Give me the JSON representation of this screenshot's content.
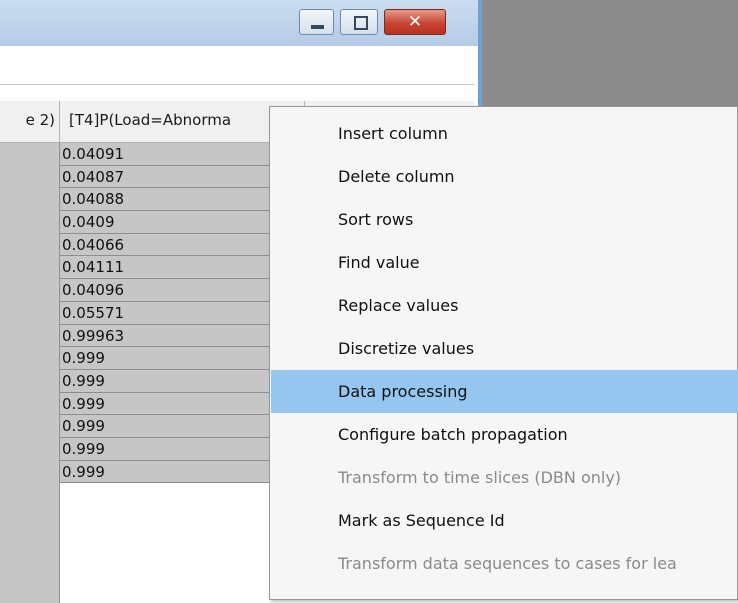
{
  "window": {
    "close_label": "✕"
  },
  "grid": {
    "headers": [
      "e 2)",
      "[T4]P(Load=Abnorma",
      ""
    ],
    "values": [
      "0.04091",
      "0.04087",
      "0.04088",
      "0.0409",
      "0.04066",
      "0.04111",
      "0.04096",
      "0.05571",
      "0.99963",
      "0.999",
      "0.999",
      "0.999",
      "0.999",
      "0.999",
      "0.999"
    ]
  },
  "menu": {
    "items": [
      {
        "label": "Insert column",
        "enabled": true
      },
      {
        "label": "Delete column",
        "enabled": true
      },
      {
        "label": "Sort rows",
        "enabled": true
      },
      {
        "label": "Find value",
        "enabled": true
      },
      {
        "label": "Replace values",
        "enabled": true
      },
      {
        "label": "Discretize values",
        "enabled": true
      },
      {
        "label": "Data processing",
        "enabled": true,
        "highlighted": true
      },
      {
        "label": "Configure batch propagation",
        "enabled": true
      },
      {
        "label": "Transform to time slices (DBN only)",
        "enabled": false
      },
      {
        "label": "Mark as Sequence Id",
        "enabled": true
      },
      {
        "label": "Transform data sequences to cases for lea",
        "enabled": false
      }
    ]
  },
  "colors": {
    "highlight": "#95c6f0",
    "cell_bg": "#c6c6c6",
    "disabled_text": "#8a8a8a"
  }
}
